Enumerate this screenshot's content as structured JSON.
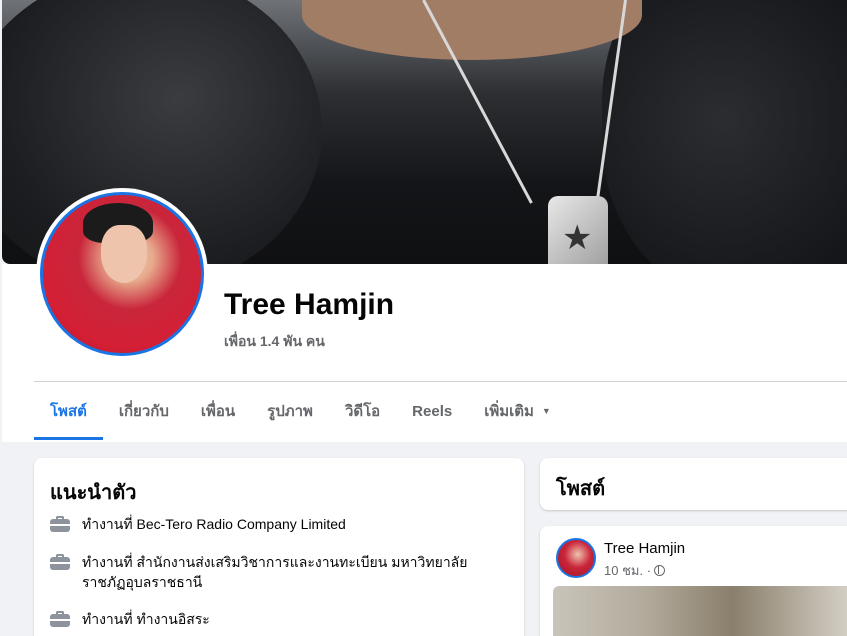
{
  "profile": {
    "name": "Tree Hamjin",
    "friends_count": "เพื่อน 1.4 พัน คน"
  },
  "tabs": [
    {
      "label": "โพสต์",
      "active": true
    },
    {
      "label": "เกี่ยวกับ",
      "active": false
    },
    {
      "label": "เพื่อน",
      "active": false
    },
    {
      "label": "รูปภาพ",
      "active": false
    },
    {
      "label": "วิดีโอ",
      "active": false
    },
    {
      "label": "Reels",
      "active": false
    },
    {
      "label": "เพิ่มเติม",
      "active": false,
      "has_caret": true
    }
  ],
  "intro": {
    "title": "แนะนำตัว",
    "items": [
      {
        "icon": "briefcase-icon",
        "text": "ทำงานที่ Bec-Tero Radio Company Limited"
      },
      {
        "icon": "briefcase-icon",
        "text": "ทำงานที่ สำนักงานส่งเสริมวิชาการและงานทะเบียน มหาวิทยาลัยราชภัฏอุบลราชธานี"
      },
      {
        "icon": "briefcase-icon",
        "text": "ทำงานที่ ทำงานอิสระ"
      }
    ]
  },
  "posts": {
    "title": "โพสต์",
    "first_post": {
      "author": "Tree Hamjin",
      "time": "10 ชม. ·",
      "privacy_icon": "globe-icon"
    }
  },
  "colors": {
    "accent": "#1b74e4",
    "background": "#f0f2f5",
    "secondary_text": "#65676b"
  }
}
